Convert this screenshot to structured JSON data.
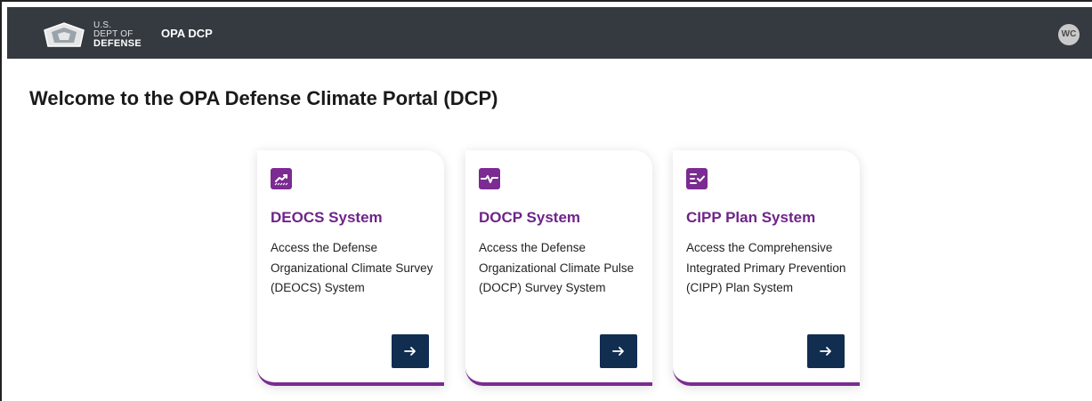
{
  "header": {
    "logo": {
      "line1": "U.S.",
      "line2": "DEPT OF",
      "line3": "DEFENSE"
    },
    "app_name": "OPA DCP",
    "avatar_initials": "WC",
    "background_color": "#343a40"
  },
  "page": {
    "title": "Welcome to the OPA Defense Climate Portal (DCP)"
  },
  "cards": [
    {
      "icon": "chart-trend-icon",
      "title": "DEOCS System",
      "description": "Access the Defense Organizational Climate Survey (DEOCS) System",
      "action_icon": "arrow-right-icon"
    },
    {
      "icon": "pulse-icon",
      "title": "DOCP System",
      "description": "Access the Defense Organizational Climate Pulse (DOCP) Survey System",
      "action_icon": "arrow-right-icon"
    },
    {
      "icon": "checklist-icon",
      "title": "CIPP Plan System",
      "description": "Access the Comprehensive Integrated Primary Prevention (CIPP) Plan System",
      "action_icon": "arrow-right-icon"
    }
  ],
  "colors": {
    "accent_purple": "#7b2b91",
    "title_purple": "#6f2489",
    "button_navy": "#112e51"
  }
}
